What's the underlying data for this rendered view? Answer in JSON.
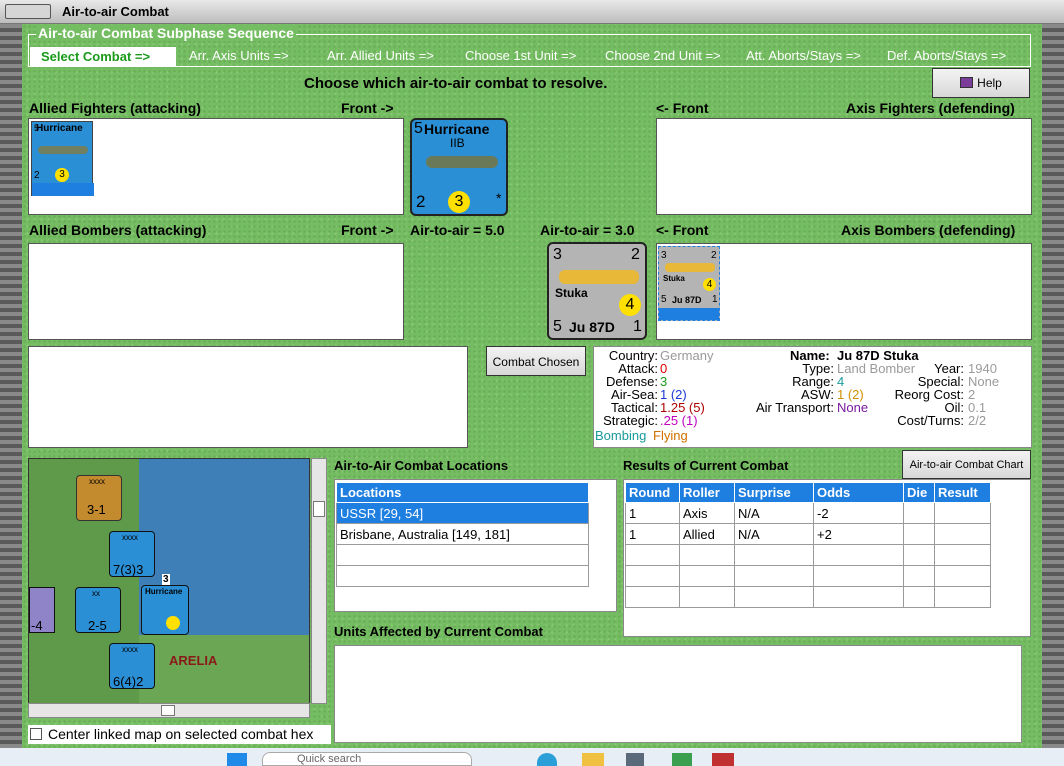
{
  "window": {
    "title": "Air-to-air Combat"
  },
  "sequence": {
    "title": "Air-to-air Combat Subphase Sequence",
    "steps": [
      "Select Combat =>",
      "Arr. Axis Units =>",
      "Arr. Allied Units =>",
      "Choose 1st Unit =>",
      "Choose 2nd Unit =>",
      "Att. Aborts/Stays =>",
      "Def. Aborts/Stays =>"
    ]
  },
  "prompt": "Choose which air-to-air combat to resolve.",
  "help_label": "Help",
  "labels": {
    "allied_fighters": "Allied Fighters (attacking)",
    "front_right": "Front ->",
    "front_left": "<- Front",
    "axis_fighters": "Axis Fighters (defending)",
    "allied_bombers": "Allied Bombers (attacking)",
    "axis_bombers": "Axis Bombers (defending)",
    "air_to_air_allied": "Air-to-air = 5.0",
    "air_to_air_axis": "Air-to-air = 3.0"
  },
  "hurricane": {
    "name": "Hurricane",
    "model": "IIB",
    "top_left": "5",
    "bottom_left": "2",
    "range": "3",
    "star": "*"
  },
  "stuka": {
    "top_left": "3",
    "top_right": "2",
    "name": "Stuka",
    "range": "4",
    "bottom_left": "5",
    "model": "Ju 87D",
    "bottom_right": "1"
  },
  "combat_chosen_label": "Combat Chosen",
  "unit_info": {
    "country_label": "Country:",
    "country": "Germany",
    "attack_label": "Attack:",
    "attack": "0",
    "defense_label": "Defense:",
    "defense": "3",
    "airsea_label": "Air-Sea:",
    "airsea": "1 (2)",
    "tactical_label": "Tactical:",
    "tactical": "1.25 (5)",
    "strategic_label": "Strategic:",
    "strategic": ".25 (1)",
    "bombing": "Bombing",
    "flying": "Flying",
    "name_label": "Name:",
    "name": "Ju 87D Stuka",
    "type_label": "Type:",
    "type": "Land Bomber",
    "year_label": "Year:",
    "year": "1940",
    "range_label": "Range:",
    "range": "4",
    "special_label": "Special:",
    "special": "None",
    "asw_label": "ASW:",
    "asw": "1 (2)",
    "reorg_label": "Reorg Cost:",
    "reorg": "2",
    "air_transport_label": "Air Transport:",
    "air_transport": "None",
    "oil_label": "Oil:",
    "oil": "0.1",
    "cost_label": "Cost/Turns:",
    "cost": "2/2"
  },
  "locations": {
    "title": "Air-to-Air Combat Locations",
    "header": "Locations",
    "rows": [
      "USSR [29, 54]",
      "Brisbane, Australia [149, 181]"
    ]
  },
  "results": {
    "title": "Results of Current Combat",
    "chart_button": "Air-to-air Combat Chart",
    "headers": [
      "Round",
      "Roller",
      "Surprise",
      "Odds",
      "Die",
      "Result"
    ],
    "rows": [
      [
        "1",
        "Axis",
        "N/A",
        "-2",
        "",
        ""
      ],
      [
        "1",
        "Allied",
        "N/A",
        "+2",
        "",
        ""
      ]
    ]
  },
  "units_affected_title": "Units Affected by Current Combat",
  "center_map_label": "Center linked map on selected combat hex",
  "map": {
    "region": "ARELIA",
    "counters": [
      "3-1",
      "7(3)3",
      "2-5",
      "-4",
      "6(4)2"
    ],
    "stack": "3",
    "corps": "xxxx",
    "army": "xx",
    "mini": "Hurricane"
  },
  "taskbar": {
    "search": "Quick search"
  }
}
